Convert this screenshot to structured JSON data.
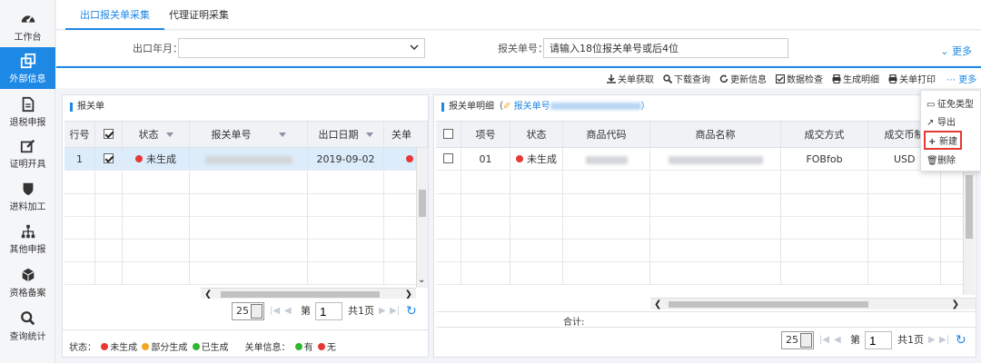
{
  "sidebar": {
    "items": [
      {
        "label": "工作台",
        "icon": "dashboard-icon"
      },
      {
        "label": "外部信息",
        "icon": "external-link-icon",
        "active": true
      },
      {
        "label": "退税申报",
        "icon": "document-icon"
      },
      {
        "label": "证明开具",
        "icon": "edit-icon"
      },
      {
        "label": "进料加工",
        "icon": "shield-icon"
      },
      {
        "label": "其他申报",
        "icon": "sitemap-icon"
      },
      {
        "label": "资格备案",
        "icon": "cube-icon"
      },
      {
        "label": "查询统计",
        "icon": "search-icon"
      }
    ]
  },
  "tabs": [
    {
      "label": "出口报关单采集",
      "active": true
    },
    {
      "label": "代理证明采集",
      "active": false
    }
  ],
  "filter": {
    "year_month_label": "出口年月：",
    "year_month_value": "",
    "declaration_no_label": "报关单号：",
    "declaration_no_value": "请输入18位报关单号或后4位",
    "more_label": "更多"
  },
  "toolbar": {
    "buttons": [
      {
        "label": "关单获取",
        "icon": "download-icon"
      },
      {
        "label": "下载查询",
        "icon": "search-icon"
      },
      {
        "label": "更新信息",
        "icon": "refresh-icon"
      },
      {
        "label": "数据检查",
        "icon": "check-square-icon"
      },
      {
        "label": "生成明细",
        "icon": "printer-icon"
      },
      {
        "label": "关单打印",
        "icon": "printer-icon"
      }
    ],
    "more_label": "更多"
  },
  "dropdown": {
    "items": [
      {
        "label": "征免类型",
        "icon": "monitor-icon"
      },
      {
        "label": "导出",
        "icon": "export-icon"
      },
      {
        "label": "新建",
        "icon": "plus-icon",
        "highlighted": true
      },
      {
        "label": "删除",
        "icon": "trash-icon"
      }
    ]
  },
  "left_panel": {
    "title": "报关单",
    "columns": [
      "行号",
      "",
      "状态",
      "报关单号",
      "出口日期",
      "关单"
    ],
    "rows": [
      {
        "line_no": "1",
        "checked": true,
        "status": "未生成",
        "declaration_no": "",
        "export_date": "2019-09-02"
      }
    ],
    "pager": {
      "page_size": "25",
      "page_label": "第",
      "page_value": "1",
      "total_label": "共1页"
    }
  },
  "right_panel": {
    "title_prefix": "报关单明细（",
    "title_link": "报关单号",
    "title_suffix": "）",
    "columns": [
      "",
      "项号",
      "状态",
      "商品代码",
      "商品名称",
      "成交方式",
      "成交币制"
    ],
    "rows": [
      {
        "checked": false,
        "item_no": "01",
        "status": "未生成",
        "commodity_code": "",
        "commodity_name": "",
        "trade_mode": "FOBfob",
        "currency": "USD"
      }
    ],
    "total_label": "合计:",
    "pager": {
      "page_size": "25",
      "page_label": "第",
      "page_value": "1",
      "total_label": "共1页"
    }
  },
  "legend": {
    "status_label": "状态：",
    "statuses": [
      {
        "label": "未生成",
        "color": "#e53935"
      },
      {
        "label": "部分生成",
        "color": "#f5a623"
      },
      {
        "label": "已生成",
        "color": "#2eb82e"
      }
    ],
    "info_label": "关单信息：",
    "infos": [
      {
        "label": "有",
        "color": "#2eb82e"
      },
      {
        "label": "无",
        "color": "#e53935"
      }
    ]
  },
  "colors": {
    "accent": "#1e88e5",
    "red": "#e53935",
    "orange": "#f5a623",
    "green": "#2eb82e"
  }
}
